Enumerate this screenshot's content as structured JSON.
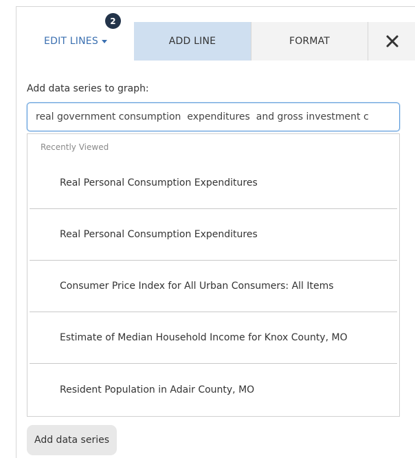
{
  "tabs": {
    "edit_lines": "EDIT LINES",
    "edit_lines_badge": "2",
    "add_line": "ADD LINE",
    "format": "FORMAT",
    "close_symbol": "✕"
  },
  "add_panel": {
    "label": "Add data series to graph:",
    "search_value": "real government consumption  expenditures  and gross investment c",
    "dropdown_header": "Recently Viewed",
    "items": [
      "Real Personal Consumption Expenditures",
      "Real Personal Consumption Expenditures",
      "Consumer Price Index for All Urban Consumers: All Items",
      "Estimate of Median Household Income for Knox County, MO",
      "Resident Population in Adair County, MO"
    ],
    "add_button": "Add data series"
  },
  "colors": {
    "accent": "#3a6fb0",
    "active_tab_bg": "#cfdff0",
    "badge_bg": "#23344a",
    "input_focus": "#5d9cdb"
  }
}
